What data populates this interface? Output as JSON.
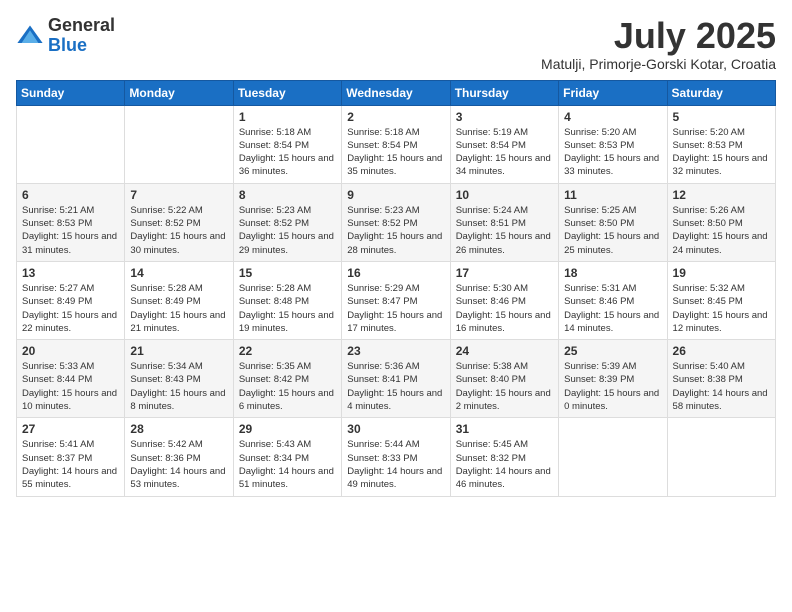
{
  "logo": {
    "general": "General",
    "blue": "Blue"
  },
  "header": {
    "month": "July 2025",
    "location": "Matulji, Primorje-Gorski Kotar, Croatia"
  },
  "weekdays": [
    "Sunday",
    "Monday",
    "Tuesday",
    "Wednesday",
    "Thursday",
    "Friday",
    "Saturday"
  ],
  "weeks": [
    [
      {
        "day": "",
        "sunrise": "",
        "sunset": "",
        "daylight": ""
      },
      {
        "day": "",
        "sunrise": "",
        "sunset": "",
        "daylight": ""
      },
      {
        "day": "1",
        "sunrise": "Sunrise: 5:18 AM",
        "sunset": "Sunset: 8:54 PM",
        "daylight": "Daylight: 15 hours and 36 minutes."
      },
      {
        "day": "2",
        "sunrise": "Sunrise: 5:18 AM",
        "sunset": "Sunset: 8:54 PM",
        "daylight": "Daylight: 15 hours and 35 minutes."
      },
      {
        "day": "3",
        "sunrise": "Sunrise: 5:19 AM",
        "sunset": "Sunset: 8:54 PM",
        "daylight": "Daylight: 15 hours and 34 minutes."
      },
      {
        "day": "4",
        "sunrise": "Sunrise: 5:20 AM",
        "sunset": "Sunset: 8:53 PM",
        "daylight": "Daylight: 15 hours and 33 minutes."
      },
      {
        "day": "5",
        "sunrise": "Sunrise: 5:20 AM",
        "sunset": "Sunset: 8:53 PM",
        "daylight": "Daylight: 15 hours and 32 minutes."
      }
    ],
    [
      {
        "day": "6",
        "sunrise": "Sunrise: 5:21 AM",
        "sunset": "Sunset: 8:53 PM",
        "daylight": "Daylight: 15 hours and 31 minutes."
      },
      {
        "day": "7",
        "sunrise": "Sunrise: 5:22 AM",
        "sunset": "Sunset: 8:52 PM",
        "daylight": "Daylight: 15 hours and 30 minutes."
      },
      {
        "day": "8",
        "sunrise": "Sunrise: 5:23 AM",
        "sunset": "Sunset: 8:52 PM",
        "daylight": "Daylight: 15 hours and 29 minutes."
      },
      {
        "day": "9",
        "sunrise": "Sunrise: 5:23 AM",
        "sunset": "Sunset: 8:52 PM",
        "daylight": "Daylight: 15 hours and 28 minutes."
      },
      {
        "day": "10",
        "sunrise": "Sunrise: 5:24 AM",
        "sunset": "Sunset: 8:51 PM",
        "daylight": "Daylight: 15 hours and 26 minutes."
      },
      {
        "day": "11",
        "sunrise": "Sunrise: 5:25 AM",
        "sunset": "Sunset: 8:50 PM",
        "daylight": "Daylight: 15 hours and 25 minutes."
      },
      {
        "day": "12",
        "sunrise": "Sunrise: 5:26 AM",
        "sunset": "Sunset: 8:50 PM",
        "daylight": "Daylight: 15 hours and 24 minutes."
      }
    ],
    [
      {
        "day": "13",
        "sunrise": "Sunrise: 5:27 AM",
        "sunset": "Sunset: 8:49 PM",
        "daylight": "Daylight: 15 hours and 22 minutes."
      },
      {
        "day": "14",
        "sunrise": "Sunrise: 5:28 AM",
        "sunset": "Sunset: 8:49 PM",
        "daylight": "Daylight: 15 hours and 21 minutes."
      },
      {
        "day": "15",
        "sunrise": "Sunrise: 5:28 AM",
        "sunset": "Sunset: 8:48 PM",
        "daylight": "Daylight: 15 hours and 19 minutes."
      },
      {
        "day": "16",
        "sunrise": "Sunrise: 5:29 AM",
        "sunset": "Sunset: 8:47 PM",
        "daylight": "Daylight: 15 hours and 17 minutes."
      },
      {
        "day": "17",
        "sunrise": "Sunrise: 5:30 AM",
        "sunset": "Sunset: 8:46 PM",
        "daylight": "Daylight: 15 hours and 16 minutes."
      },
      {
        "day": "18",
        "sunrise": "Sunrise: 5:31 AM",
        "sunset": "Sunset: 8:46 PM",
        "daylight": "Daylight: 15 hours and 14 minutes."
      },
      {
        "day": "19",
        "sunrise": "Sunrise: 5:32 AM",
        "sunset": "Sunset: 8:45 PM",
        "daylight": "Daylight: 15 hours and 12 minutes."
      }
    ],
    [
      {
        "day": "20",
        "sunrise": "Sunrise: 5:33 AM",
        "sunset": "Sunset: 8:44 PM",
        "daylight": "Daylight: 15 hours and 10 minutes."
      },
      {
        "day": "21",
        "sunrise": "Sunrise: 5:34 AM",
        "sunset": "Sunset: 8:43 PM",
        "daylight": "Daylight: 15 hours and 8 minutes."
      },
      {
        "day": "22",
        "sunrise": "Sunrise: 5:35 AM",
        "sunset": "Sunset: 8:42 PM",
        "daylight": "Daylight: 15 hours and 6 minutes."
      },
      {
        "day": "23",
        "sunrise": "Sunrise: 5:36 AM",
        "sunset": "Sunset: 8:41 PM",
        "daylight": "Daylight: 15 hours and 4 minutes."
      },
      {
        "day": "24",
        "sunrise": "Sunrise: 5:38 AM",
        "sunset": "Sunset: 8:40 PM",
        "daylight": "Daylight: 15 hours and 2 minutes."
      },
      {
        "day": "25",
        "sunrise": "Sunrise: 5:39 AM",
        "sunset": "Sunset: 8:39 PM",
        "daylight": "Daylight: 15 hours and 0 minutes."
      },
      {
        "day": "26",
        "sunrise": "Sunrise: 5:40 AM",
        "sunset": "Sunset: 8:38 PM",
        "daylight": "Daylight: 14 hours and 58 minutes."
      }
    ],
    [
      {
        "day": "27",
        "sunrise": "Sunrise: 5:41 AM",
        "sunset": "Sunset: 8:37 PM",
        "daylight": "Daylight: 14 hours and 55 minutes."
      },
      {
        "day": "28",
        "sunrise": "Sunrise: 5:42 AM",
        "sunset": "Sunset: 8:36 PM",
        "daylight": "Daylight: 14 hours and 53 minutes."
      },
      {
        "day": "29",
        "sunrise": "Sunrise: 5:43 AM",
        "sunset": "Sunset: 8:34 PM",
        "daylight": "Daylight: 14 hours and 51 minutes."
      },
      {
        "day": "30",
        "sunrise": "Sunrise: 5:44 AM",
        "sunset": "Sunset: 8:33 PM",
        "daylight": "Daylight: 14 hours and 49 minutes."
      },
      {
        "day": "31",
        "sunrise": "Sunrise: 5:45 AM",
        "sunset": "Sunset: 8:32 PM",
        "daylight": "Daylight: 14 hours and 46 minutes."
      },
      {
        "day": "",
        "sunrise": "",
        "sunset": "",
        "daylight": ""
      },
      {
        "day": "",
        "sunrise": "",
        "sunset": "",
        "daylight": ""
      }
    ]
  ]
}
